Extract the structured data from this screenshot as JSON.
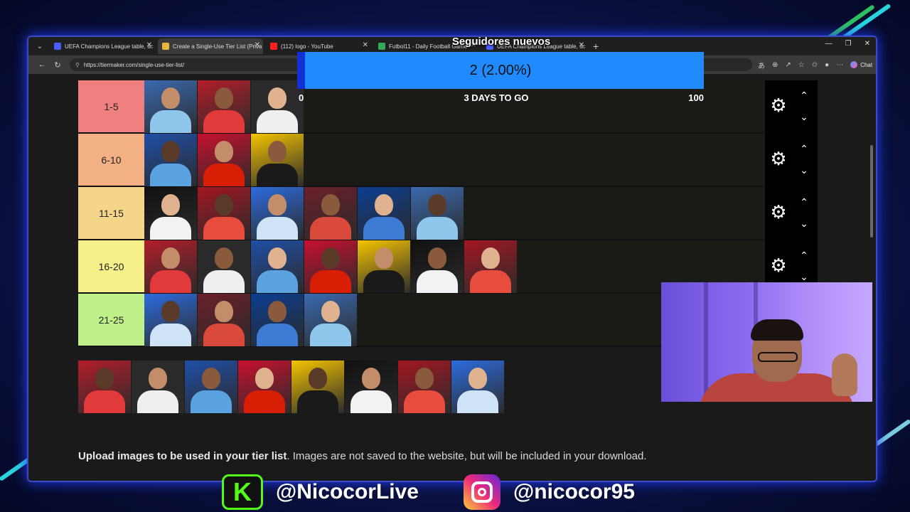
{
  "colors": {
    "accent_blue": "#1f8bff",
    "goal_fill": "#1330d8",
    "kick_green": "#53fc18",
    "tier_colors": [
      "#f08080",
      "#f3b084",
      "#f5d58a",
      "#f6ef8a",
      "#bff08a"
    ]
  },
  "browser": {
    "tabs": [
      {
        "label": "UEFA Champions League table, sc",
        "fav_color": "#4a5cff",
        "active": false
      },
      {
        "label": "Create a Single-Use Tier List (Priva",
        "fav_color": "#e8b63b",
        "active": true
      },
      {
        "label": "(112) logo - YouTube",
        "fav_color": "#ff2020",
        "active": false
      },
      {
        "label": "Futbol11 - Daily Football Game",
        "fav_color": "#33aa55",
        "active": false
      },
      {
        "label": "UEFA Champions League table, sc",
        "fav_color": "#4a5cff",
        "active": false
      }
    ],
    "url": "https://tiermaker.com/single-use-tier-list/",
    "chat_label": "Chat"
  },
  "tiers": [
    {
      "label": "1-5",
      "count": 3
    },
    {
      "label": "6-10",
      "count": 3
    },
    {
      "label": "11-15",
      "count": 6
    },
    {
      "label": "16-20",
      "count": 7
    },
    {
      "label": "21-25",
      "count": 4
    }
  ],
  "pool_count": 8,
  "upload": {
    "bold": "Upload images to be used in your tier list",
    "rest": ". Images are not saved to the website, but will be included in your download."
  },
  "goal": {
    "title": "Seguidores nuevos",
    "value_text": "2 (2.00%)",
    "fraction": 0.02,
    "min": "0",
    "max": "100",
    "time_left": "3 DAYS TO GO"
  },
  "socials": {
    "kick": "@NicocorLive",
    "instagram": "@nicocor95"
  }
}
